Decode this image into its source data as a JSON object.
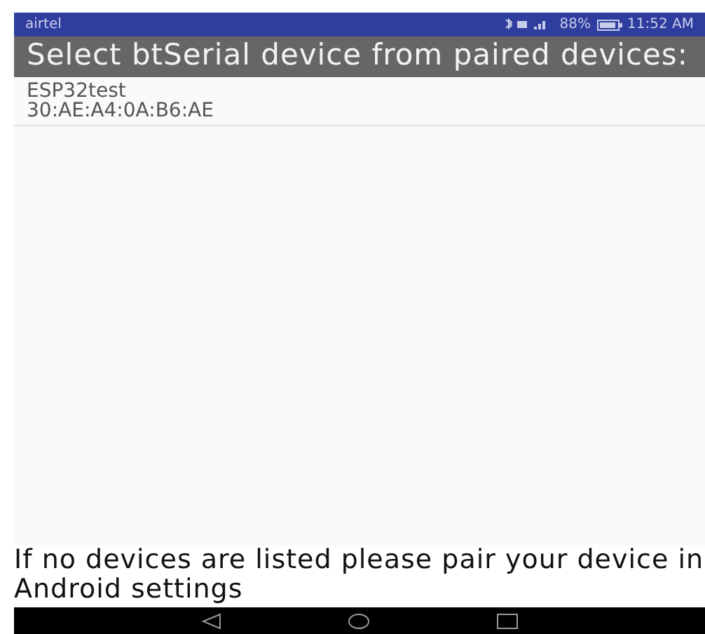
{
  "status_bar": {
    "carrier": "airtel",
    "battery": "88%",
    "time": "11:52 AM"
  },
  "title": "Select btSerial device from paired devices:",
  "devices": [
    {
      "name": "ESP32test",
      "address": "30:AE:A4:0A:B6:AE"
    }
  ],
  "footer": "If no devices are listed please pair your device in Android settings"
}
